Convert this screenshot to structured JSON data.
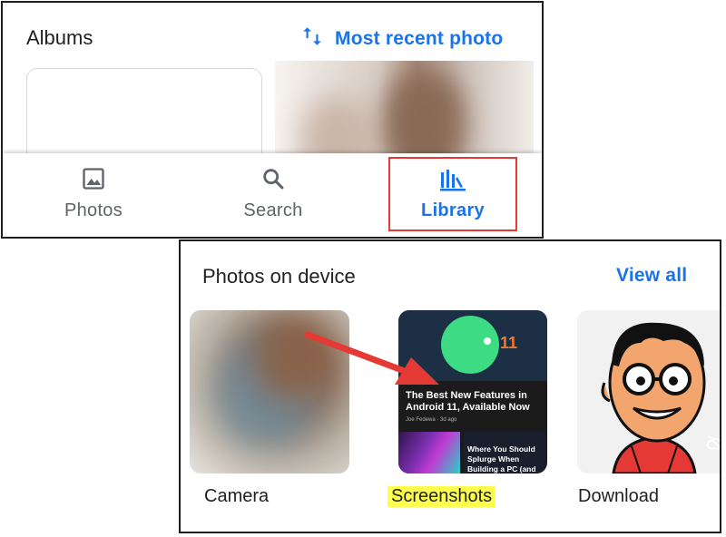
{
  "albums_panel": {
    "title": "Albums",
    "sort_label": "Most recent photo",
    "sort_icon": "swap-vert-icon"
  },
  "bottom_nav": {
    "items": [
      {
        "label": "Photos",
        "icon": "image-icon"
      },
      {
        "label": "Search",
        "icon": "search-icon"
      },
      {
        "label": "Library",
        "icon": "library-icon",
        "selected": true
      }
    ]
  },
  "device_panel": {
    "title": "Photos on device",
    "view_all": "View all",
    "folders": [
      {
        "label": "Camera"
      },
      {
        "label": "Screenshots",
        "highlighted": true
      },
      {
        "label": "Download"
      }
    ],
    "screenshot_thumb": {
      "badge": "11",
      "headline": "The Best New Features in Android 11, Available Now",
      "byline": "Joe Fedewa · 3d ago",
      "sub_headline": "Where You Should Splurge When Building a PC (and"
    }
  },
  "colors": {
    "accent": "#1a73e8",
    "highlight_box": "#e53935",
    "highlight_text": "#ffff4d",
    "arrow": "#e53935"
  }
}
